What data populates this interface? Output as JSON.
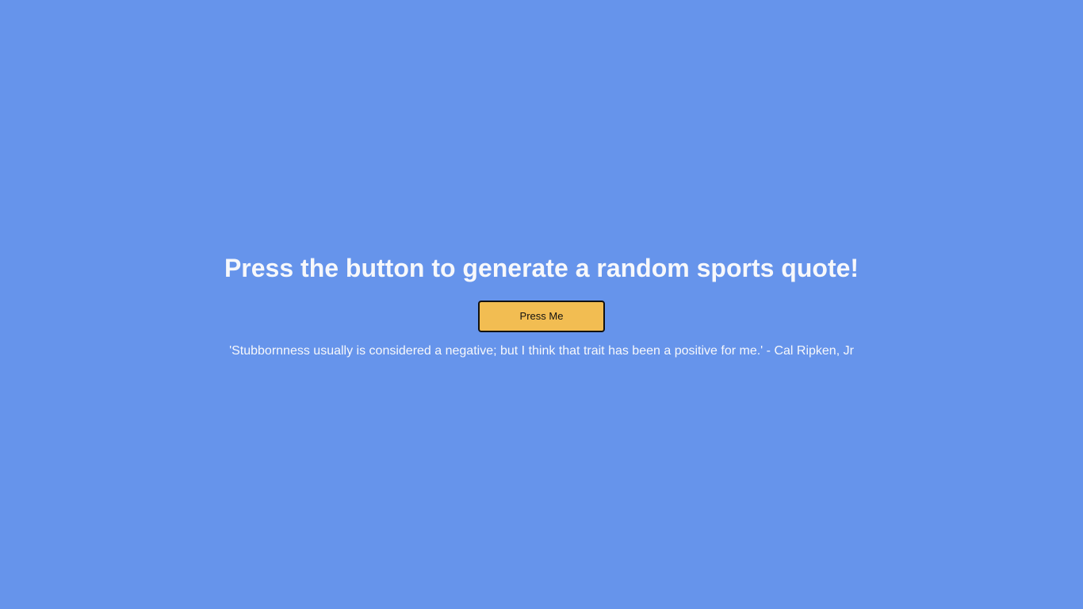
{
  "main": {
    "heading": "Press the button to generate a random sports quote!",
    "button_label": "Press Me",
    "quote": "'Stubbornness usually is considered a negative; but I think that trait has been a positive for me.' - Cal Ripken, Jr"
  },
  "colors": {
    "background": "#6694eb",
    "button": "#f2bd52",
    "text": "#f7f8fb"
  }
}
